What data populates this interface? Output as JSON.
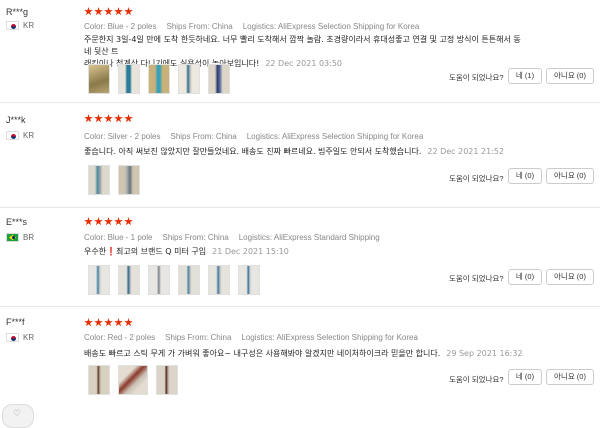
{
  "reviews": [
    {
      "user": "R***g",
      "country": "KR",
      "flag": "kr",
      "rating": 5,
      "color": "Color: Blue - 2 poles",
      "ships_from": "Ships From: China",
      "logistics": "Logistics: AliExpress Selection Shipping for Korea",
      "text_line1": "주문한지 3일-4일 만에 도착 한듯하네요. 너무 빨리 도착해서 깜짝 놀람. 초경량이라서 휴대성좋고 연결 및 고정 방식이 튼튼해서 동네 뒷산 트",
      "text_line2": "래킹이나 청계산 다니기에도 실용성이 높아보입니다!",
      "date": "22 Dec 2021 03:50",
      "thumbs": 5,
      "helpful_label": "도움이 되었나요?",
      "yes_label": "네 (1)",
      "no_label": "아니요 (0)"
    },
    {
      "user": "J***k",
      "country": "KR",
      "flag": "kr",
      "rating": 5,
      "color": "Color: Silver - 2 poles",
      "ships_from": "Ships From: China",
      "logistics": "Logistics: AliExpress Selection Shipping for Korea",
      "text_line1": "좋습니다. 아직 써보진 않았지만 잘만들었네요. 배송도 진짜 빠르네요. 빔주일도 안되서 도착했습니다.",
      "text_line2": "",
      "date": "22 Dec 2021 21:52",
      "thumbs": 2,
      "helpful_label": "도움이 되었나요?",
      "yes_label": "네 (0)",
      "no_label": "아니요 (0)"
    },
    {
      "user": "E***s",
      "country": "BR",
      "flag": "br",
      "rating": 5,
      "color": "Color: Blue - 1 pole",
      "ships_from": "Ships From: China",
      "logistics": "Logistics: AliExpress Standard Shipping",
      "text_line1": "우수한❗최고의 브랜드 Q 미터 구입",
      "text_line2": "",
      "date": "21 Dec 2021 15:10",
      "thumbs": 6,
      "helpful_label": "도움이 되었나요?",
      "yes_label": "네 (0)",
      "no_label": "아니요 (0)"
    },
    {
      "user": "F***f",
      "country": "KR",
      "flag": "kr",
      "rating": 5,
      "color": "Color: Red - 2 poles",
      "ships_from": "Ships From: China",
      "logistics": "Logistics: AliExpress Selection Shipping for Korea",
      "text_line1": "배송도 빠르고 스틱 무게 가 가벼워 좋아요~ 내구성은 사용해봐야 알겠지만 네이처하이크라 믿을만 합니다.",
      "text_line2": "",
      "date": "29 Sep 2021 16:32",
      "thumbs": 3,
      "helpful_label": "도움이 되었나요?",
      "yes_label": "네 (0)",
      "no_label": "아니요 (0)"
    }
  ],
  "colors": {
    "star": "#e62e04",
    "meta": "#888888"
  }
}
